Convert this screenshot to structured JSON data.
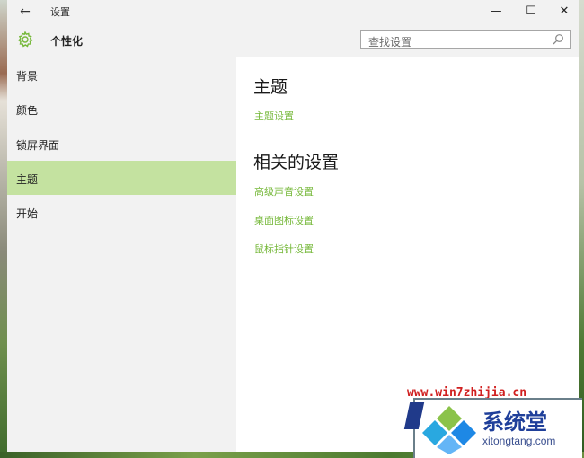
{
  "window": {
    "title": "设置",
    "back_glyph": "←",
    "controls": {
      "minimize": "—",
      "maximize": "☐",
      "close": "✕"
    }
  },
  "header": {
    "section_title": "个性化",
    "icon": "gear-icon",
    "search": {
      "value": "查找设置",
      "icon": "search-icon"
    }
  },
  "sidebar": {
    "items": [
      {
        "label": "背景",
        "selected": false
      },
      {
        "label": "颜色",
        "selected": false
      },
      {
        "label": "锁屏界面",
        "selected": false
      },
      {
        "label": "主题",
        "selected": true
      },
      {
        "label": "开始",
        "selected": false
      }
    ]
  },
  "content": {
    "theme_heading": "主题",
    "theme_link": "主题设置",
    "related_heading": "相关的设置",
    "related_links": [
      "高级声音设置",
      "桌面图标设置",
      "鼠标指针设置"
    ]
  },
  "watermark": {
    "url": "www.win7zhijia.cn",
    "brand_cn": "系统堂",
    "brand_en": "xitongtang.com"
  },
  "colors": {
    "accent": "#76b83a",
    "selected_bg": "#c4e2a0",
    "chrome_bg": "#f2f2f2"
  }
}
